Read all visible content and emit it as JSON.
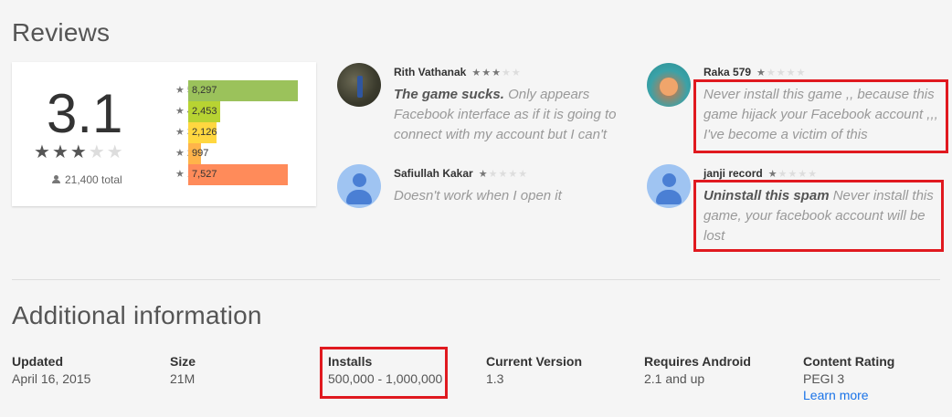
{
  "reviews": {
    "title": "Reviews",
    "score": "3.1",
    "total": "21,400 total",
    "average_rating": 3.1,
    "histogram": [
      {
        "label": "5",
        "value": "8,297",
        "count": 8297,
        "color": "#9bc25b"
      },
      {
        "label": "4",
        "value": "2,453",
        "count": 2453,
        "color": "#b8d332"
      },
      {
        "label": "3",
        "value": "2,126",
        "count": 2126,
        "color": "#ffd740"
      },
      {
        "label": "2",
        "value": "997",
        "count": 997,
        "color": "#ffb44a"
      },
      {
        "label": "1",
        "value": "7,527",
        "count": 7527,
        "color": "#ff8b5a"
      }
    ],
    "items": [
      {
        "name": "Rith Vathanak",
        "rating": 3,
        "bold": "The game sucks.",
        "text": "Only appears Facebook interface as if it is going to connect with my account but I can't"
      },
      {
        "name": "Raka 579",
        "rating": 1,
        "bold": "",
        "text": "Never install this game ,, because this game hijack your Facebook account ,,, I've become a victim of this"
      },
      {
        "name": "Safiullah Kakar",
        "rating": 1,
        "bold": "",
        "text": "Doesn't work when I open it"
      },
      {
        "name": "janji record",
        "rating": 1,
        "bold": "Uninstall this spam",
        "text": "Never install this game, your facebook account will be lost"
      }
    ]
  },
  "additional": {
    "title": "Additional information",
    "fields": [
      {
        "label": "Updated",
        "value": "April 16, 2015"
      },
      {
        "label": "Size",
        "value": "21M"
      },
      {
        "label": "Installs",
        "value": "500,000 - 1,000,000"
      },
      {
        "label": "Current Version",
        "value": "1.3"
      },
      {
        "label": "Requires Android",
        "value": "2.1 and up"
      },
      {
        "label": "Content Rating",
        "value": "PEGI 3",
        "link": "Learn more"
      }
    ]
  },
  "colors": {
    "highlight": "#e0191f",
    "link": "#1a73e8"
  }
}
